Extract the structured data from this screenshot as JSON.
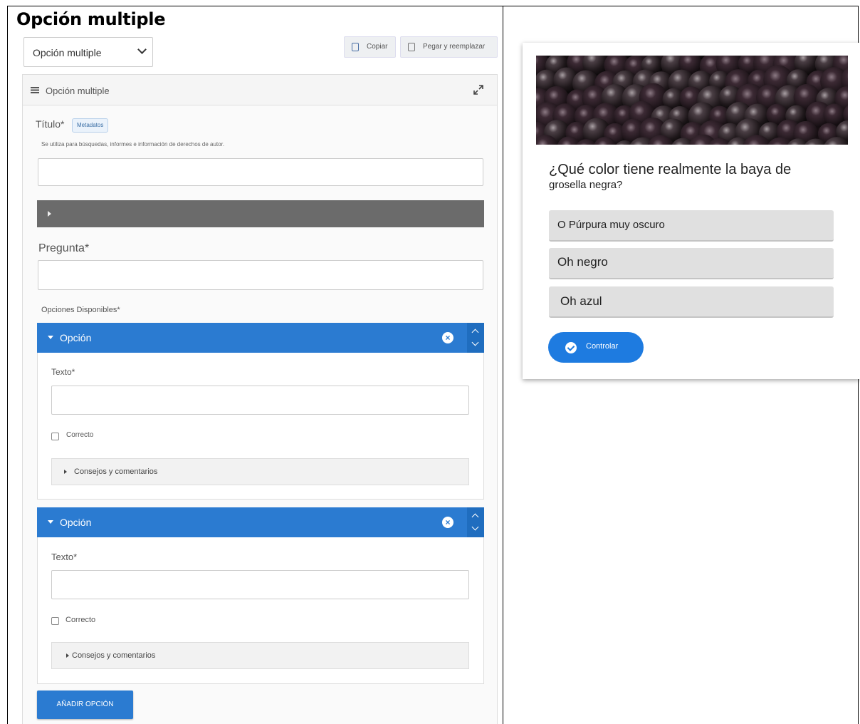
{
  "heading": "Opción multiple",
  "editor": {
    "content_type_select": "Opción multiple",
    "copy_label": "Copiar",
    "paste_label": "Pegar y reemplazar",
    "panel_title": "Opción multiple",
    "title_label": "Título*",
    "metadata_badge": "Metadatos",
    "title_help": "Se utiliza para búsquedas, informes e información de derechos de autor.",
    "question_label": "Pregunta*",
    "options_label": "Opciones Disponibles*",
    "options": [
      {
        "header": "Opción",
        "text_label": "Texto*",
        "correct_label": "Correcto",
        "tips_label": "Consejos y comentarios"
      },
      {
        "header": "Opción",
        "text_label": "Texto*",
        "correct_label": "Correcto",
        "tips_label": "Consejos y comentarios"
      }
    ],
    "add_option_label": "AÑADIR OPCIÓN"
  },
  "preview": {
    "question_line1": "¿Qué color tiene realmente la baya de",
    "question_line2": "grosella negra?",
    "answers": [
      "O Púrpura muy oscuro",
      "Oh negro",
      "Oh azul"
    ],
    "check_label": "Controlar"
  },
  "colors": {
    "accent": "#2b7bd1",
    "check_button": "#1e7be0",
    "media_bar": "#6b6b6b"
  }
}
